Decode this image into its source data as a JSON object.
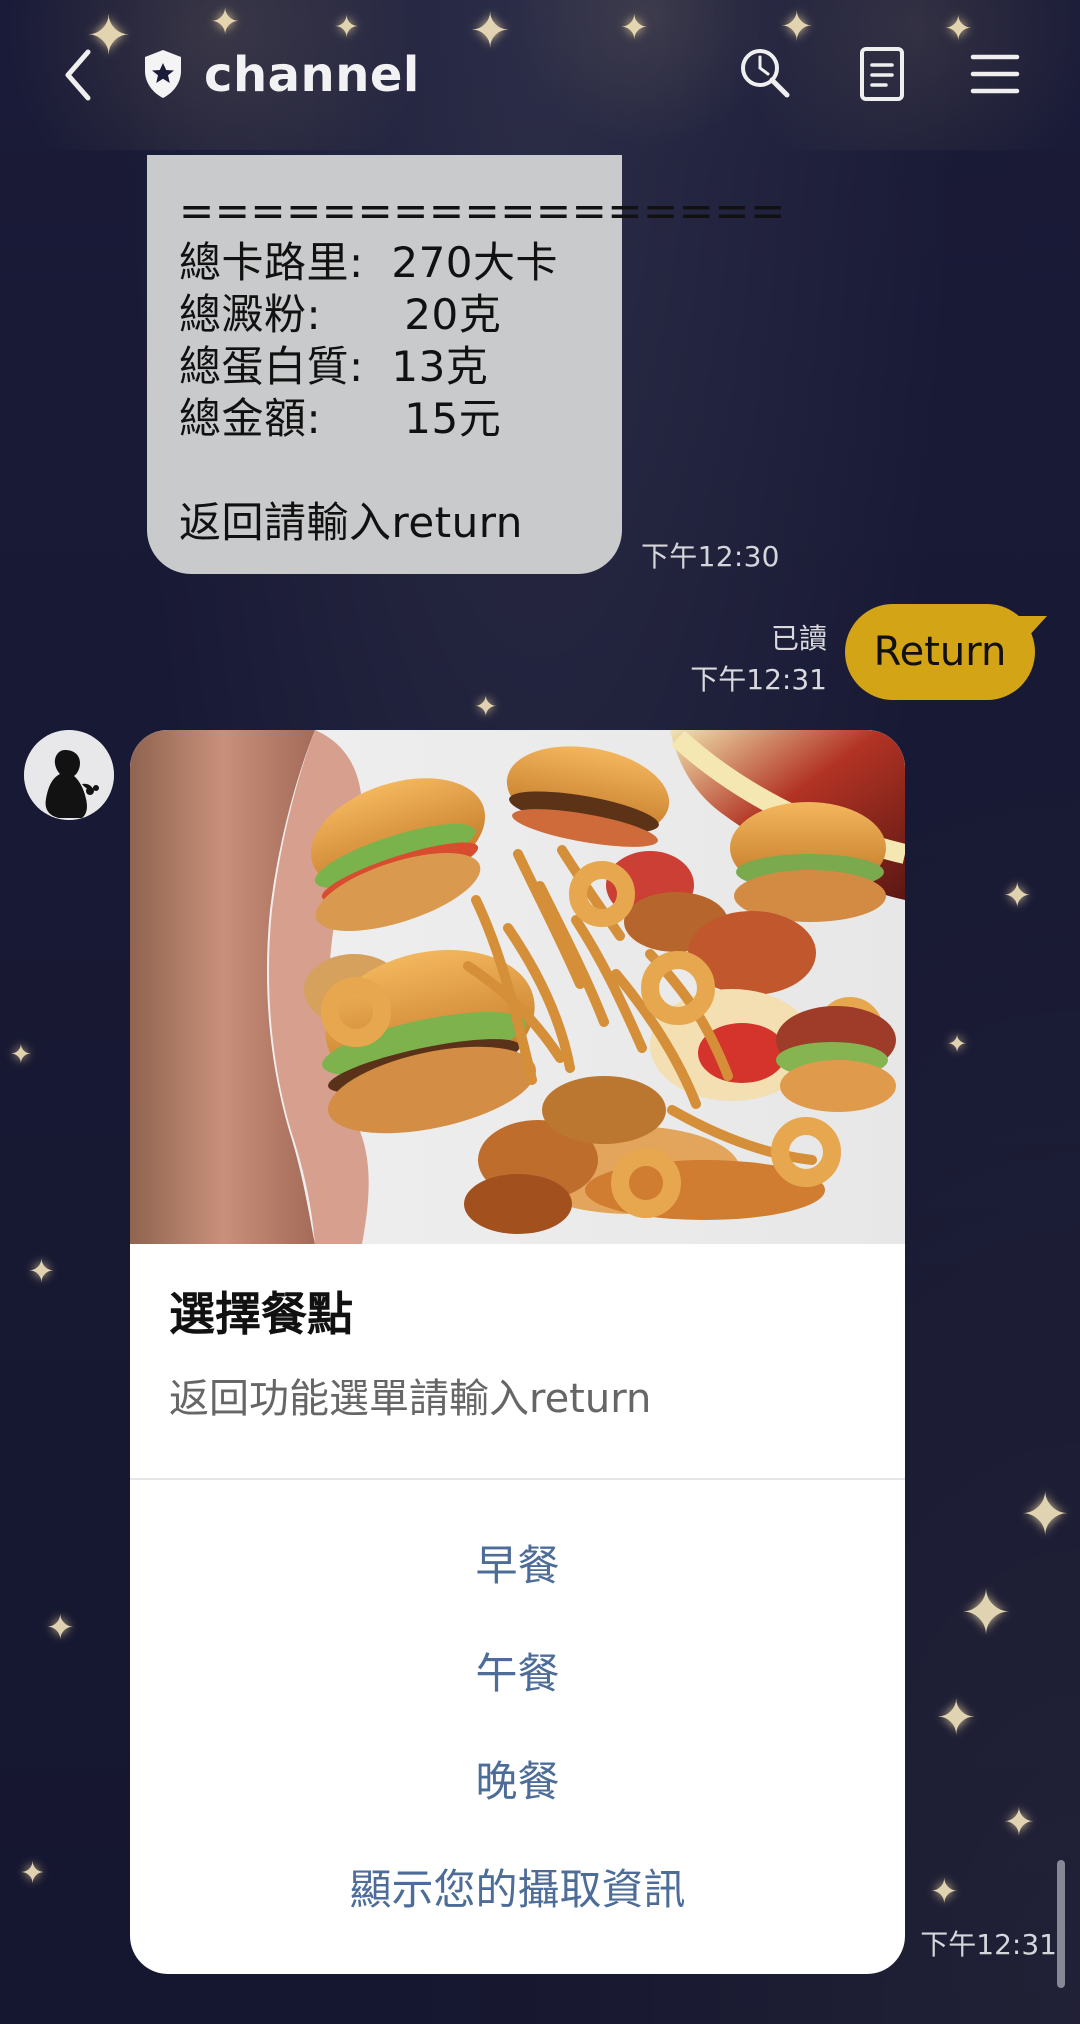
{
  "header": {
    "title": "channel"
  },
  "chat": {
    "bot_message": {
      "lines": [
        "=================",
        "總卡路里:  270大卡",
        "總澱粉:      20克",
        "總蛋白質:  13克",
        "總金額:      15元",
        "",
        "返回請輸入return"
      ],
      "time": "下午12:30"
    },
    "user_message": {
      "read_status": "已讀",
      "time": "下午12:31",
      "text": "Return"
    },
    "card_message": {
      "title": "選擇餐點",
      "description": "返回功能選單請輸入return",
      "actions": [
        "早餐",
        "午餐",
        "晚餐",
        "顯示您的攝取資訊"
      ],
      "time": "下午12:31"
    }
  },
  "colors": {
    "background": "#1b1c3a",
    "bot_bubble": "#c9cacc",
    "user_bubble": "#d4a417",
    "card_action": "#4d6d98",
    "card_background": "#ffffff"
  },
  "icons": {
    "back": "chevron-left-icon",
    "shield": "shield-star-icon",
    "search": "search-icon",
    "notes": "notes-icon",
    "menu": "menu-icon",
    "avatar": "avatar-silhouette-icon"
  }
}
